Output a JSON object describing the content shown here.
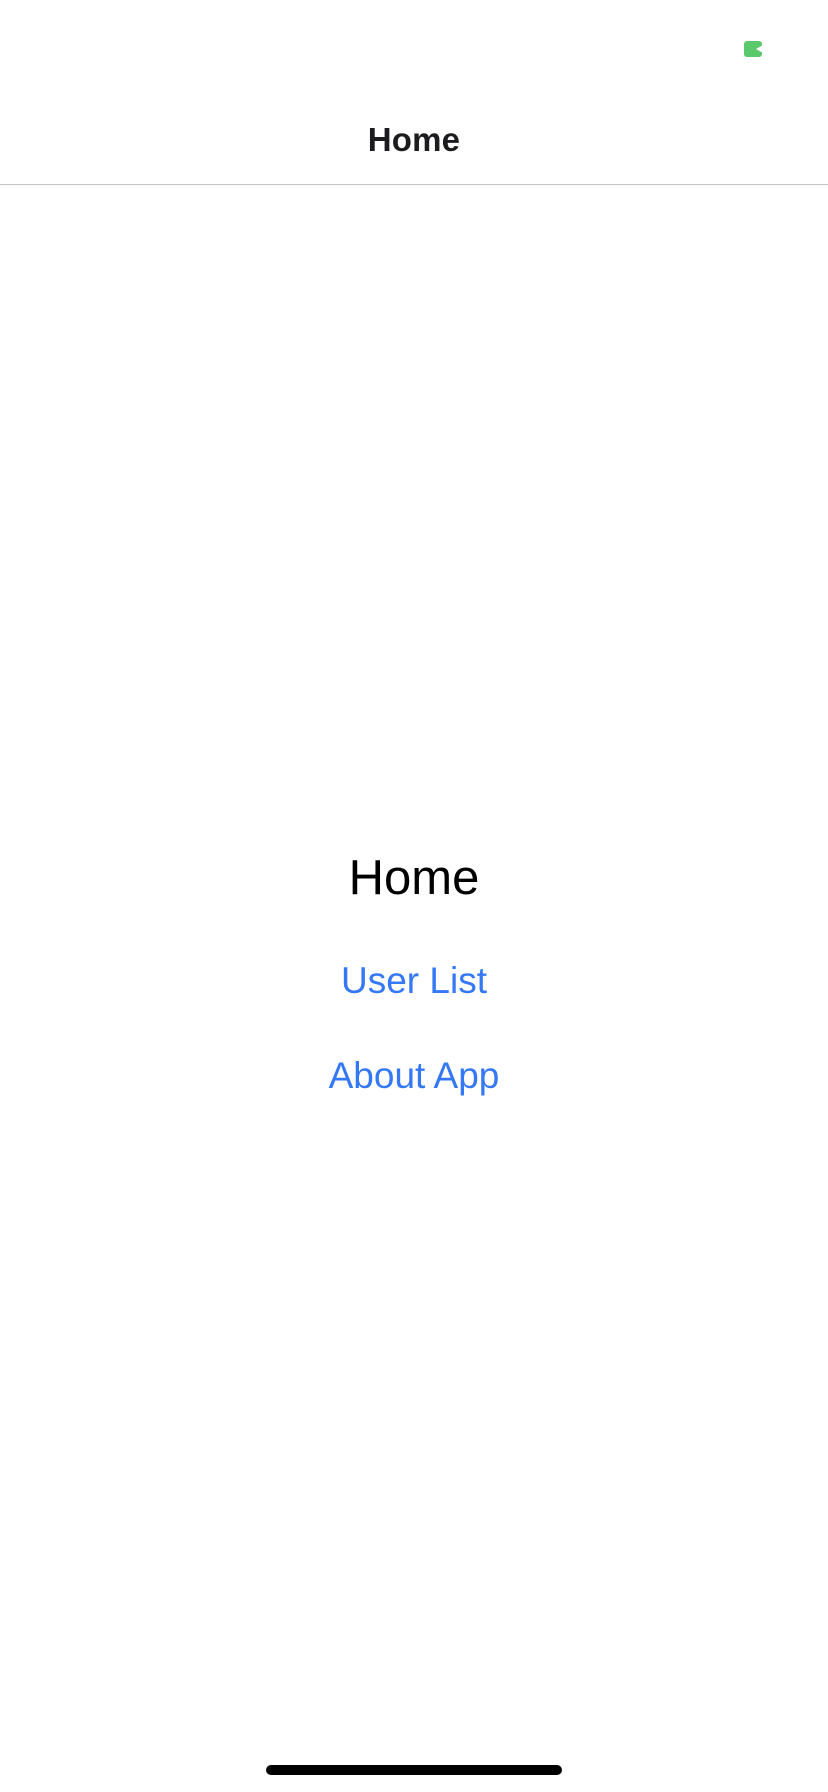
{
  "nav_bar": {
    "title": "Home"
  },
  "main": {
    "heading": "Home",
    "links": [
      {
        "label": "User List"
      },
      {
        "label": "About App"
      }
    ]
  },
  "status_bar": {
    "indicator_color": "#5bc96b"
  },
  "colors": {
    "link": "#3478f6",
    "background": "#ffffff",
    "divider": "#c4c4c6"
  }
}
